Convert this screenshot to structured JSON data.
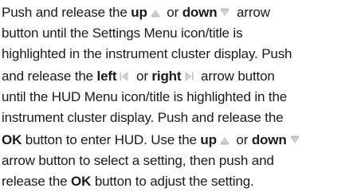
{
  "paragraph": {
    "l1": {
      "a": "Push and release the ",
      "up": "up",
      "b": " or ",
      "down": "down",
      "c": " arrow"
    },
    "l2": "button until the Settings Menu icon/title is",
    "l3": "highlighted in the instrument cluster display. Push",
    "l4": {
      "a": "and release the ",
      "left": "left",
      "b": " or ",
      "right": "right",
      "c": " arrow button"
    },
    "l5": "until the HUD Menu icon/title is highlighted in the",
    "l6": "instrument cluster display. Push and release the",
    "l7": {
      "ok": "OK",
      "a": " button to enter HUD. Use the ",
      "up": "up",
      "b": " or ",
      "down": "down"
    },
    "l8": "arrow button to select a setting, then push and",
    "l9": {
      "a": "release the ",
      "ok": "OK",
      "b": " button to adjust the setting."
    }
  },
  "icons": {
    "up": "up-arrow-icon",
    "down": "down-arrow-icon",
    "left": "left-arrow-icon",
    "right": "right-arrow-icon",
    "color": "#c8c8c8"
  }
}
